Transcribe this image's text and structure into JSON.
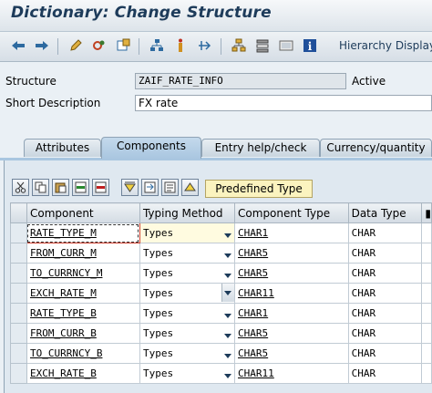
{
  "window": {
    "title": "Dictionary: Change Structure"
  },
  "toolbar": {
    "icons": [
      "back-icon",
      "forward-icon",
      "edit-icon",
      "activate-icon",
      "object-list-icon",
      "where-used-icon",
      "info-icon",
      "navigate-icon",
      "hierarchy-icon",
      "tree-icon",
      "display-icon",
      "information-icon"
    ],
    "hierarchy_label": "Hierarchy Display"
  },
  "header": {
    "structure_label": "Structure",
    "structure_value": "ZAIF_RATE_INFO",
    "status": "Active",
    "short_desc_label": "Short Description",
    "short_desc_value": "FX rate"
  },
  "tabs": [
    "Attributes",
    "Components",
    "Entry help/check",
    "Currency/quantity"
  ],
  "active_tab": "Components",
  "grid_toolbar": {
    "icons": [
      "cut-icon",
      "copy-icon",
      "paste-icon",
      "insert-row-icon",
      "delete-row-icon",
      "find-icon",
      "find-next-icon",
      "details-icon",
      "up-icon"
    ],
    "predefined_type": "Predefined Type"
  },
  "table": {
    "columns": [
      "Component",
      "Typing Method",
      "Component Type",
      "Data Type"
    ],
    "rows": [
      {
        "component": "RATE_TYPE_M",
        "typing": "Types",
        "type": "CHAR1",
        "data_type": "CHAR"
      },
      {
        "component": "FROM_CURR_M",
        "typing": "Types",
        "type": "CHAR5",
        "data_type": "CHAR"
      },
      {
        "component": "TO_CURRNCY_M",
        "typing": "Types",
        "type": "CHAR5",
        "data_type": "CHAR"
      },
      {
        "component": "EXCH_RATE_M",
        "typing": "Types",
        "type": "CHAR11",
        "data_type": "CHAR"
      },
      {
        "component": "RATE_TYPE_B",
        "typing": "Types",
        "type": "CHAR1",
        "data_type": "CHAR"
      },
      {
        "component": "FROM_CURR_B",
        "typing": "Types",
        "type": "CHAR5",
        "data_type": "CHAR"
      },
      {
        "component": "TO_CURRNCY_B",
        "typing": "Types",
        "type": "CHAR5",
        "data_type": "CHAR"
      },
      {
        "component": "EXCH_RATE_B",
        "typing": "Types",
        "type": "CHAR11",
        "data_type": "CHAR"
      }
    ]
  }
}
